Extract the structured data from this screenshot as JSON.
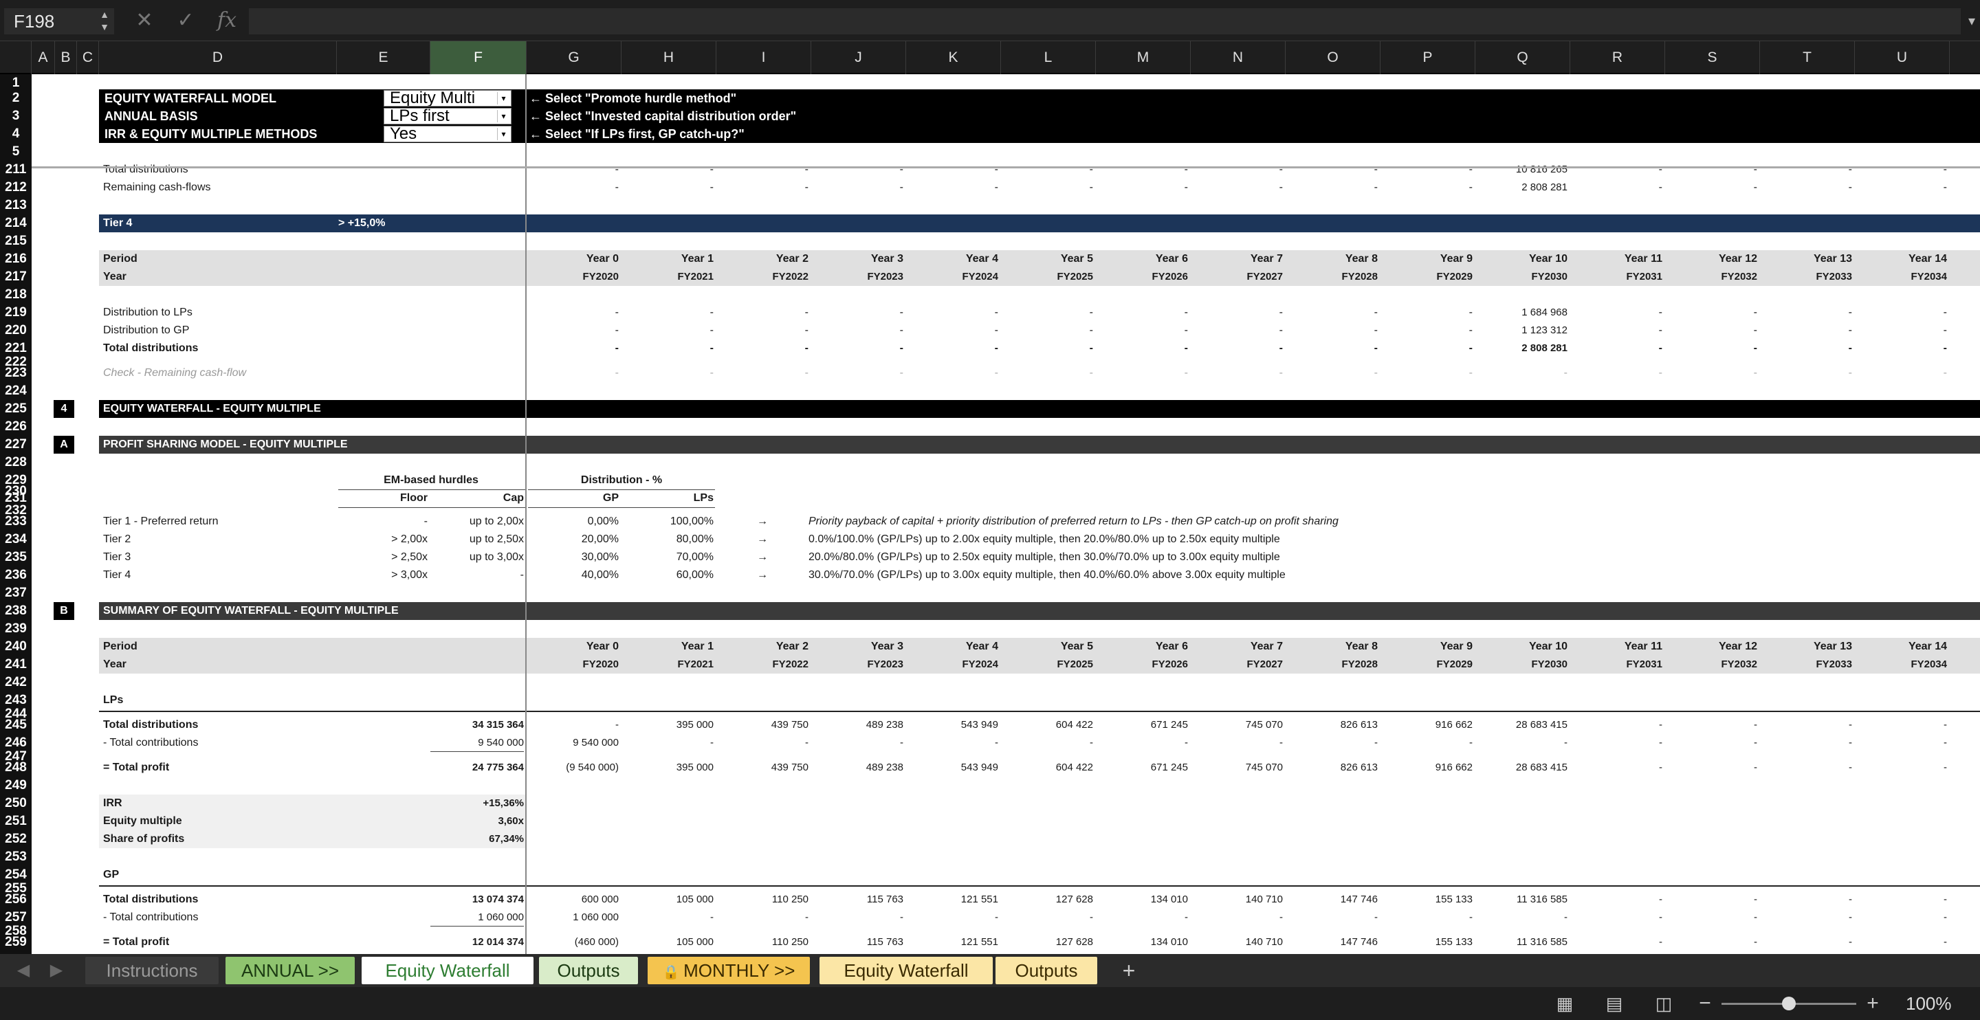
{
  "formula_bar": {
    "name_box": "F198",
    "cancel": "✕",
    "enter": "✓",
    "fx": "fx",
    "value": ""
  },
  "columns": [
    "A",
    "B",
    "C",
    "D",
    "E",
    "F",
    "G",
    "H",
    "I",
    "J",
    "K",
    "L",
    "M",
    "N",
    "O",
    "P",
    "Q",
    "R",
    "S",
    "T",
    "U"
  ],
  "selected_column": "F",
  "rows": {
    "r1": "1",
    "r2": "2",
    "r3": "3",
    "r4": "4",
    "r5": "5",
    "r211": "211",
    "r212": "212",
    "r213": "213",
    "r214": "214",
    "r215": "215",
    "r216": "216",
    "r217": "217",
    "r218": "218",
    "r219": "219",
    "r220": "220",
    "r221": "221",
    "r222": "222",
    "r223": "223",
    "r224": "224",
    "r225": "225",
    "r226": "226",
    "r227": "227",
    "r228": "228",
    "r229": "229",
    "r230": "230",
    "r231": "231",
    "r232": "232",
    "r233": "233",
    "r234": "234",
    "r235": "235",
    "r236": "236",
    "r237": "237",
    "r238": "238",
    "r239": "239",
    "r240": "240",
    "r241": "241",
    "r242": "242",
    "r243": "243",
    "r244": "244",
    "r245": "245",
    "r246": "246",
    "r247": "247",
    "r248": "248",
    "r249": "249",
    "r250": "250",
    "r251": "251",
    "r252": "252",
    "r253": "253",
    "r254": "254",
    "r255": "255",
    "r256": "256",
    "r257": "257",
    "r258": "258",
    "r259": "259"
  },
  "top_panel": {
    "title1": "EQUITY WATERFALL MODEL",
    "title2": "ANNUAL BASIS",
    "title3": "IRR & EQUITY MULTIPLE METHODS",
    "dd1": "Equity Multi",
    "dd2": "LPs first",
    "dd3": "Yes",
    "hint1": "← Select \"Promote hurdle method\"",
    "hint2": "← Select \"Invested capital distribution order\"",
    "hint3": "← Select \"If LPs first, GP catch-up?\""
  },
  "upper": {
    "total_distributions": "Total distributions",
    "remaining": "Remaining cash-flows",
    "q211": "10 816 265",
    "q212": "2 808 281",
    "tier4": "Tier 4",
    "tier4_hurdle": "> +15,0%",
    "period": "Period",
    "year": "Year",
    "dist_lps": "Distribution to LPs",
    "dist_gp": "Distribution to GP",
    "total_dist": "Total distributions",
    "q219": "1 684 968",
    "q220": "1 123 312",
    "q221": "2 808 281",
    "check": "Check - Remaining cash-flow",
    "dash": "-"
  },
  "periods": [
    "Year 0",
    "Year 1",
    "Year 2",
    "Year 3",
    "Year 4",
    "Year 5",
    "Year 6",
    "Year 7",
    "Year 8",
    "Year 9",
    "Year 10",
    "Year 11",
    "Year 12",
    "Year 13",
    "Year 14"
  ],
  "fiscal_years": [
    "FY2020",
    "FY2021",
    "FY2022",
    "FY2023",
    "FY2024",
    "FY2025",
    "FY2026",
    "FY2027",
    "FY2028",
    "FY2029",
    "FY2030",
    "FY2031",
    "FY2032",
    "FY2033",
    "FY2034"
  ],
  "section4": {
    "num": "4",
    "title": "EQUITY WATERFALL - EQUITY MULTIPLE"
  },
  "sectionA": {
    "num": "A",
    "title": "PROFIT SHARING MODEL - EQUITY MULTIPLE"
  },
  "sectionB": {
    "num": "B",
    "title": "SUMMARY OF EQUITY WATERFALL - EQUITY MULTIPLE"
  },
  "hurdles": {
    "hdr_em": "EM-based hurdles",
    "hdr_dist": "Distribution - %",
    "floor": "Floor",
    "cap": "Cap",
    "gp": "GP",
    "lps": "LPs",
    "tiers": [
      {
        "name": "Tier 1 - Preferred return",
        "floor": "-",
        "cap": "up to 2,00x",
        "gp": "0,00%",
        "lps": "100,00%",
        "arrow": "→",
        "desc": "Priority payback of capital + priority distribution of preferred return to LPs - then GP catch-up on profit sharing"
      },
      {
        "name": "Tier 2",
        "floor": "> 2,00x",
        "cap": "up to 2,50x",
        "gp": "20,00%",
        "lps": "80,00%",
        "arrow": "→",
        "desc": "0.0%/100.0% (GP/LPs) up to 2.00x equity multiple, then 20.0%/80.0% up to 2.50x equity multiple"
      },
      {
        "name": "Tier 3",
        "floor": "> 2,50x",
        "cap": "up to 3,00x",
        "gp": "30,00%",
        "lps": "70,00%",
        "arrow": "→",
        "desc": "20.0%/80.0% (GP/LPs) up to 2.50x equity multiple, then 30.0%/70.0% up to 3.00x equity multiple"
      },
      {
        "name": "Tier 4",
        "floor": "> 3,00x",
        "cap": "-",
        "gp": "40,00%",
        "lps": "60,00%",
        "arrow": "→",
        "desc": "30.0%/70.0% (GP/LPs) up to 3.00x equity multiple, then 40.0%/60.0% above 3.00x equity multiple"
      }
    ]
  },
  "summary": {
    "period": "Period",
    "year": "Year",
    "lps_label": "LPs",
    "gp_label": "GP",
    "lps": {
      "total_dist_label": "Total distributions",
      "total_dist_total": "34 315 364",
      "total_dist": [
        "-",
        "395 000",
        "439 750",
        "489 238",
        "543 949",
        "604 422",
        "671 245",
        "745 070",
        "826 613",
        "916 662",
        "28 683 415",
        "-",
        "-",
        "-",
        "-"
      ],
      "contrib_label": "- Total contributions",
      "contrib_total": "9 540 000",
      "contrib": [
        "9 540 000",
        "-",
        "-",
        "-",
        "-",
        "-",
        "-",
        "-",
        "-",
        "-",
        "-",
        "-",
        "-",
        "-",
        "-"
      ],
      "profit_label": "= Total profit",
      "profit_total": "24 775 364",
      "profit": [
        "(9 540 000)",
        "395 000",
        "439 750",
        "489 238",
        "543 949",
        "604 422",
        "671 245",
        "745 070",
        "826 613",
        "916 662",
        "28 683 415",
        "-",
        "-",
        "-",
        "-"
      ],
      "irr_label": "IRR",
      "irr": "+15,36%",
      "em_label": "Equity multiple",
      "em": "3,60x",
      "share_label": "Share of profits",
      "share": "67,34%"
    },
    "gp": {
      "total_dist_label": "Total distributions",
      "total_dist_total": "13 074 374",
      "total_dist": [
        "600 000",
        "105 000",
        "110 250",
        "115 763",
        "121 551",
        "127 628",
        "134 010",
        "140 710",
        "147 746",
        "155 133",
        "11 316 585",
        "-",
        "-",
        "-",
        "-"
      ],
      "contrib_label": "- Total contributions",
      "contrib_total": "1 060 000",
      "contrib": [
        "1 060 000",
        "-",
        "-",
        "-",
        "-",
        "-",
        "-",
        "-",
        "-",
        "-",
        "-",
        "-",
        "-",
        "-",
        "-"
      ],
      "profit_label": "= Total profit",
      "profit_total": "12 014 374",
      "profit": [
        "(460 000)",
        "105 000",
        "110 250",
        "115 763",
        "121 551",
        "127 628",
        "134 010",
        "140 710",
        "147 746",
        "155 133",
        "11 316 585",
        "-",
        "-",
        "-",
        "-"
      ]
    }
  },
  "tabs": [
    {
      "label": "Instructions",
      "bg": "#3a3a3a",
      "fg": "#9a9a9a"
    },
    {
      "label": "ANNUAL >>",
      "bg": "#8fc46f",
      "fg": "#1b3a12"
    },
    {
      "label": "Equity Waterfall",
      "bg": "#ffffff",
      "fg": "#2e7d32"
    },
    {
      "label": "Outputs",
      "bg": "#d9ecc9",
      "fg": "#1b3a12"
    },
    {
      "label": "MONTHLY >>",
      "bg": "#f4c44f",
      "fg": "#3a2a00"
    },
    {
      "label": "Equity Waterfall",
      "bg": "#fbe6a6",
      "fg": "#3a2a00"
    },
    {
      "label": "Outputs",
      "bg": "#fbe6a6",
      "fg": "#3a2a00"
    }
  ],
  "add_tab": "+",
  "status": {
    "zoom": "100%",
    "zoom_fraction": 0.5,
    "minus": "−",
    "plus": "+"
  }
}
